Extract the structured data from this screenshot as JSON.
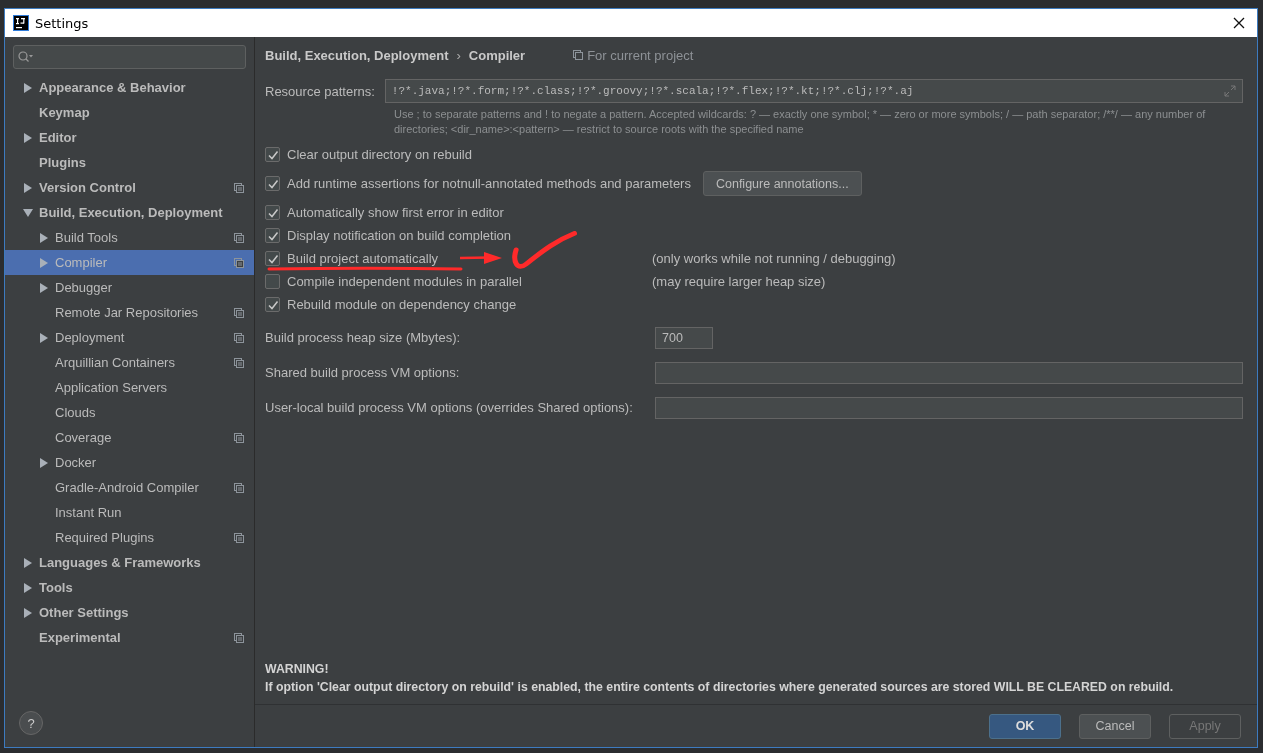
{
  "window": {
    "title": "Settings"
  },
  "sidebar": {
    "items": [
      {
        "label": "Appearance & Behavior",
        "expanded": false,
        "selected": false,
        "project_scoped": false
      },
      {
        "label": "Keymap",
        "selected": false,
        "project_scoped": false
      },
      {
        "label": "Editor",
        "expanded": false,
        "selected": false,
        "project_scoped": false
      },
      {
        "label": "Plugins",
        "selected": false,
        "project_scoped": false
      },
      {
        "label": "Version Control",
        "expanded": false,
        "selected": false,
        "project_scoped": true
      },
      {
        "label": "Build, Execution, Deployment",
        "expanded": true,
        "selected": false,
        "project_scoped": false,
        "children": [
          {
            "label": "Build Tools",
            "expanded": false,
            "selected": false,
            "project_scoped": true
          },
          {
            "label": "Compiler",
            "expanded": false,
            "selected": true,
            "project_scoped": true
          },
          {
            "label": "Debugger",
            "expanded": false,
            "selected": false,
            "project_scoped": false
          },
          {
            "label": "Remote Jar Repositories",
            "selected": false,
            "project_scoped": true
          },
          {
            "label": "Deployment",
            "expanded": false,
            "selected": false,
            "project_scoped": true
          },
          {
            "label": "Arquillian Containers",
            "selected": false,
            "project_scoped": true
          },
          {
            "label": "Application Servers",
            "selected": false,
            "project_scoped": false
          },
          {
            "label": "Clouds",
            "selected": false,
            "project_scoped": false
          },
          {
            "label": "Coverage",
            "selected": false,
            "project_scoped": true
          },
          {
            "label": "Docker",
            "expanded": false,
            "selected": false,
            "project_scoped": false
          },
          {
            "label": "Gradle-Android Compiler",
            "selected": false,
            "project_scoped": true
          },
          {
            "label": "Instant Run",
            "selected": false,
            "project_scoped": false
          },
          {
            "label": "Required Plugins",
            "selected": false,
            "project_scoped": true
          }
        ]
      },
      {
        "label": "Languages & Frameworks",
        "expanded": false,
        "selected": false,
        "project_scoped": false
      },
      {
        "label": "Tools",
        "expanded": false,
        "selected": false,
        "project_scoped": false
      },
      {
        "label": "Other Settings",
        "expanded": false,
        "selected": false,
        "project_scoped": false
      },
      {
        "label": "Experimental",
        "selected": false,
        "project_scoped": true
      }
    ]
  },
  "breadcrumb": [
    "Build, Execution, Deployment",
    "›",
    "Compiler"
  ],
  "scope_note": "For current project",
  "resource_patterns": {
    "label": "Resource patterns:",
    "value": "!?*.java;!?*.form;!?*.class;!?*.groovy;!?*.scala;!?*.flex;!?*.kt;!?*.clj;!?*.aj",
    "help": "Use ; to separate patterns and ! to negate a pattern. Accepted wildcards: ? — exactly one symbol; * — zero or more symbols; / — path separator; /**/ — any number of directories;  <dir_name>:<pattern> — restrict to source roots with the specified name"
  },
  "options": [
    {
      "label": "Clear output directory on rebuild",
      "checked": true
    },
    {
      "label": "Add runtime assertions for notnull-annotated methods and parameters",
      "checked": true,
      "button": "Configure annotations..."
    },
    {
      "label": "Automatically show first error in editor",
      "checked": true
    },
    {
      "label": "Display notification on build completion",
      "checked": true
    },
    {
      "label": "Build project automatically",
      "checked": true,
      "note": "(only works while not running / debugging)"
    },
    {
      "label": "Compile independent modules in parallel",
      "checked": false,
      "note": "(may require larger heap size)"
    },
    {
      "label": "Rebuild module on dependency change",
      "checked": true
    }
  ],
  "fields": [
    {
      "label": "Build process heap size (Mbytes):",
      "value": "700",
      "kind": "short"
    },
    {
      "label": "Shared build process VM options:",
      "kind": "wide"
    },
    {
      "label": "User-local build process VM options (overrides Shared options):",
      "kind": "wide"
    }
  ],
  "warning": {
    "title": "WARNING!",
    "text": "If option 'Clear output directory on rebuild' is enabled, the entire contents of directories where generated sources are stored WILL BE CLEARED on rebuild."
  },
  "help_button": "?",
  "buttons": [
    {
      "label": "OK",
      "kind": "default",
      "disabled": false
    },
    {
      "label": "Cancel",
      "kind": "normal",
      "disabled": false
    },
    {
      "label": "Apply",
      "kind": "normal",
      "disabled": true
    }
  ]
}
